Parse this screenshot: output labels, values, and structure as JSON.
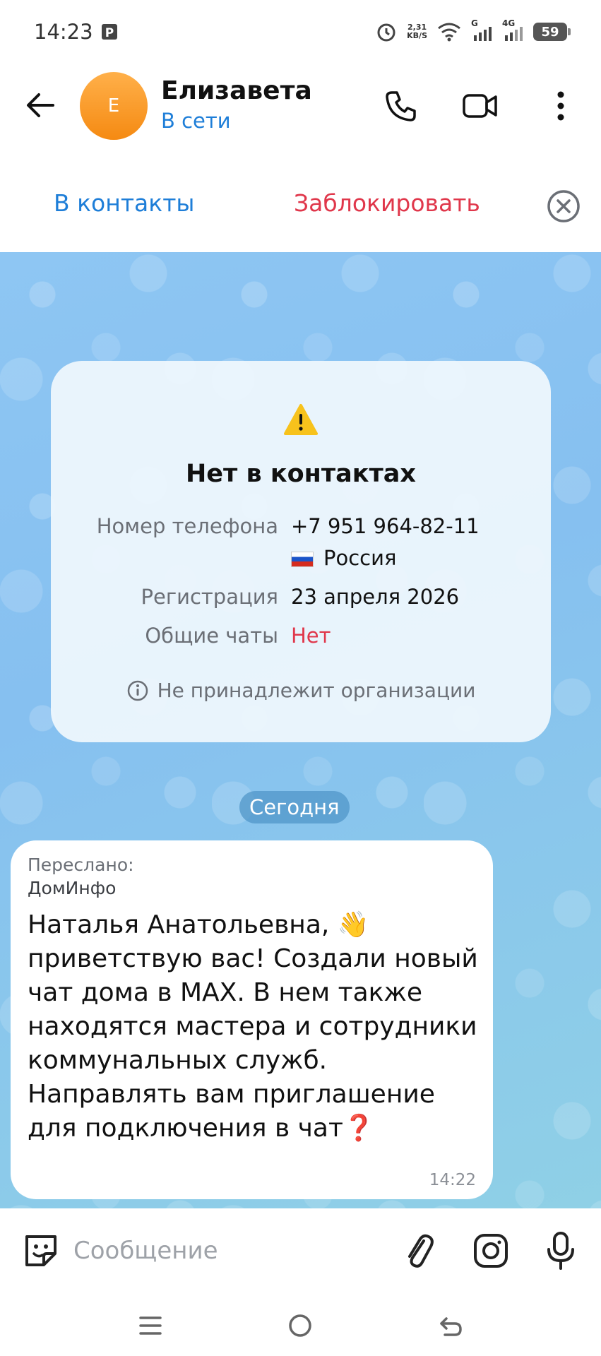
{
  "status_bar": {
    "time": "14:23",
    "net_speed_value": "2,31",
    "net_speed_unit": "KB/S",
    "network_g": "G",
    "network_4g": "4G",
    "battery": "59"
  },
  "header": {
    "avatar_initial": "Е",
    "name": "Елизавета",
    "status": "В сети"
  },
  "actions": {
    "add_contact": "В контакты",
    "block": "Заблокировать"
  },
  "info_card": {
    "title": "Нет в контактах",
    "phone_label": "Номер телефона",
    "phone_value": "+7 951 964-82-11",
    "country": "Россия",
    "registration_label": "Регистрация",
    "registration_value": "23 апреля 2026",
    "common_chats_label": "Общие чаты",
    "common_chats_value": "Нет",
    "org_note": "Не принадлежит организации"
  },
  "date_chip": "Сегодня",
  "message": {
    "forwarded_label": "Переслано:",
    "forwarded_from": "ДомИнфо",
    "text": "Наталья Анатольевна, 👋 приветствую вас! Создали новый чат дома в MAX. В нем также находятся мастера и сотрудники коммунальных служб. Направлять вам приглашение для подключения в чат❓",
    "time": "14:22"
  },
  "composer": {
    "placeholder": "Сообщение"
  },
  "colors": {
    "accent": "#1e7ed8",
    "danger": "#e0374b",
    "avatar": "#f58a12"
  }
}
